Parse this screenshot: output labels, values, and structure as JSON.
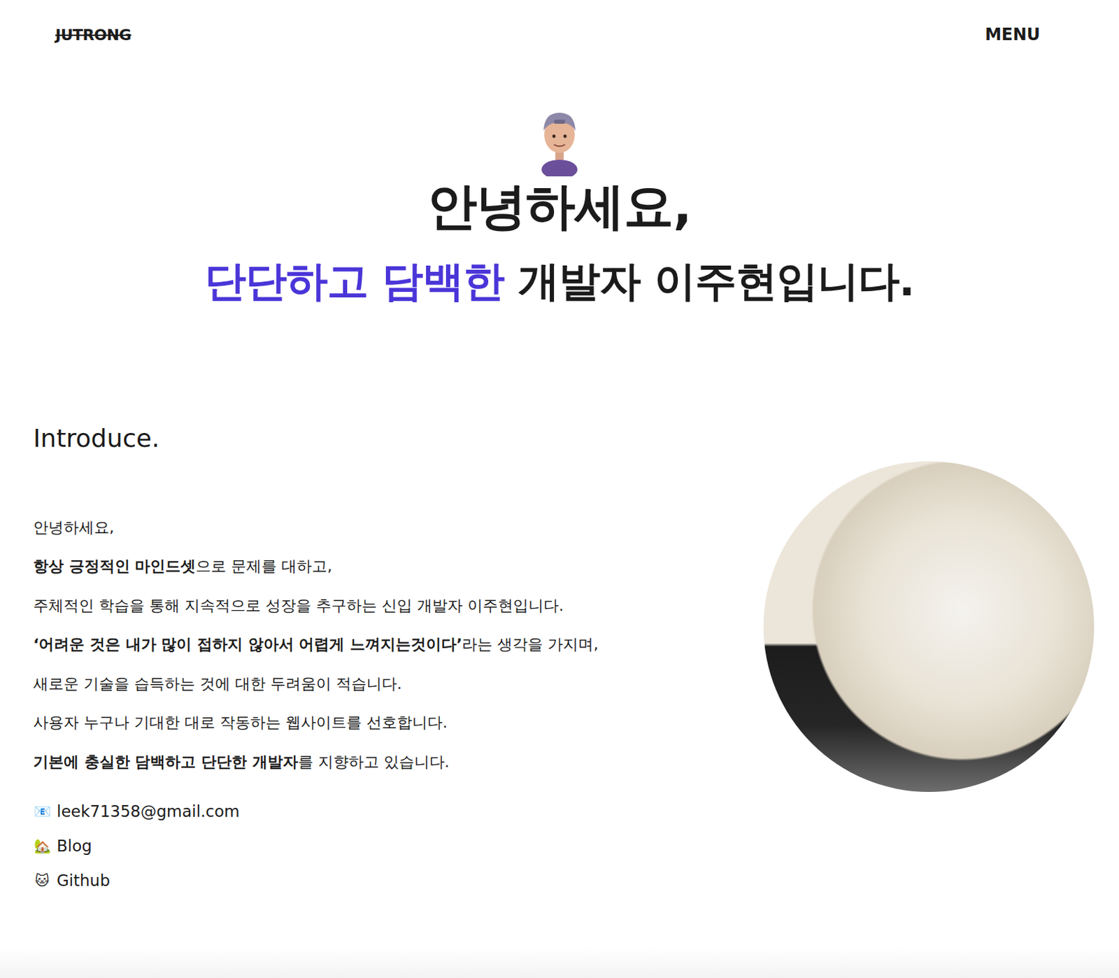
{
  "header": {
    "logo": "JUTRONG",
    "menu": "MENU"
  },
  "hero": {
    "greeting": "안녕하세요,",
    "highlight": "단단하고 담백한",
    "rest": " 개발자 이주현입니다."
  },
  "introduce": {
    "title": "Introduce.",
    "lines": [
      [
        {
          "text": "안녕하세요,",
          "bold": false
        }
      ],
      [
        {
          "text": "항상 긍정적인 마인드셋",
          "bold": true
        },
        {
          "text": "으로 문제를 대하고,",
          "bold": false
        }
      ],
      [
        {
          "text": "주체적인 학습을 통해 지속적으로 성장을 추구하는 신입 개발자 이주현입니다.",
          "bold": false
        }
      ],
      [
        {
          "text": "‘어려운 것은 내가 많이 접하지 않아서 어렵게 느껴지는것이다’",
          "bold": true
        },
        {
          "text": "라는 생각을 가지며,",
          "bold": false
        }
      ],
      [
        {
          "text": "새로운 기술을 습득하는 것에 대한 두려움이 적습니다.",
          "bold": false
        }
      ],
      [
        {
          "text": "사용자 누구나 기대한 대로 작동하는 웹사이트를 선호합니다.",
          "bold": false
        }
      ],
      [
        {
          "text": "기본에 충실한 담백하고 단단한 개발자",
          "bold": true
        },
        {
          "text": "를 지향하고 있습니다.",
          "bold": false
        }
      ]
    ]
  },
  "contacts": [
    {
      "icon": "📧",
      "label": "leek71358@gmail.com"
    },
    {
      "icon": "🏡",
      "label": "Blog"
    },
    {
      "icon": "🐱",
      "label": "Github"
    }
  ]
}
